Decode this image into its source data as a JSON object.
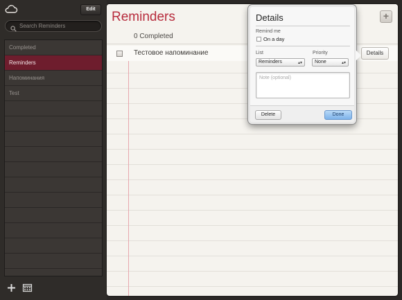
{
  "sidebar": {
    "cloud_icon": "icloud-icon",
    "edit_label": "Edit",
    "search_placeholder": "Search Reminders",
    "items": [
      {
        "label": "Completed",
        "selected": false
      },
      {
        "label": "Reminders",
        "selected": true
      },
      {
        "label": "Напоминания",
        "selected": false
      },
      {
        "label": "Test",
        "selected": false
      }
    ],
    "add_icon": "plus-icon",
    "calendar_icon": "calendar-icon"
  },
  "main": {
    "title": "Reminders",
    "add_icon": "plus-icon",
    "completed_text": "0 Completed",
    "reminders": [
      {
        "text": "Тестовое напоминание",
        "checked": false
      }
    ],
    "details_button": "Details"
  },
  "popover": {
    "title": "Details",
    "remind_me_label": "Remind me",
    "on_a_day_label": "On a day",
    "list_label": "List",
    "list_value": "Reminders",
    "priority_label": "Priority",
    "priority_value": "None",
    "note_placeholder": "Note (optional)",
    "delete_label": "Delete",
    "done_label": "Done"
  },
  "colors": {
    "accent_red": "#b72c3d",
    "selected_row": "#6e1d2d",
    "done_blue": "#7db2ea"
  }
}
